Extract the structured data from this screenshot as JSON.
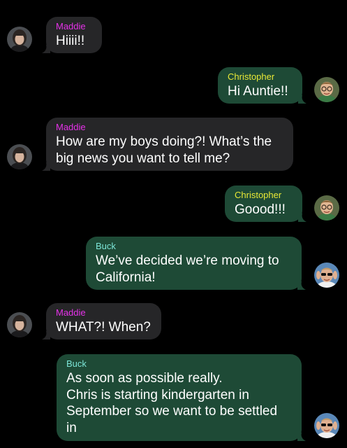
{
  "colors": {
    "maddie": "#e532e8",
    "christopher": "#e8e836",
    "buck": "#7de6d8",
    "incoming_bubble": "#262628",
    "outgoing_bubble": "#1e4a36",
    "background": "#000000"
  },
  "messages": [
    {
      "sender": "Maddie",
      "text": "Hiiii!!"
    },
    {
      "sender": "Christopher",
      "text": "Hi Auntie!!"
    },
    {
      "sender": "Maddie",
      "text": "How are my boys doing?! What’s the\nbig news you want to tell me?"
    },
    {
      "sender": "Christopher",
      "text": "Goood!!!"
    },
    {
      "sender": "Buck",
      "text": "We’ve decided we’re moving to\nCalifornia!"
    },
    {
      "sender": "Maddie",
      "text": "WHAT?! When?"
    },
    {
      "sender": "Buck",
      "text": "As soon as possible really.\nChris is starting kindergarten in\nSeptember so we want to be settled\nin"
    }
  ]
}
